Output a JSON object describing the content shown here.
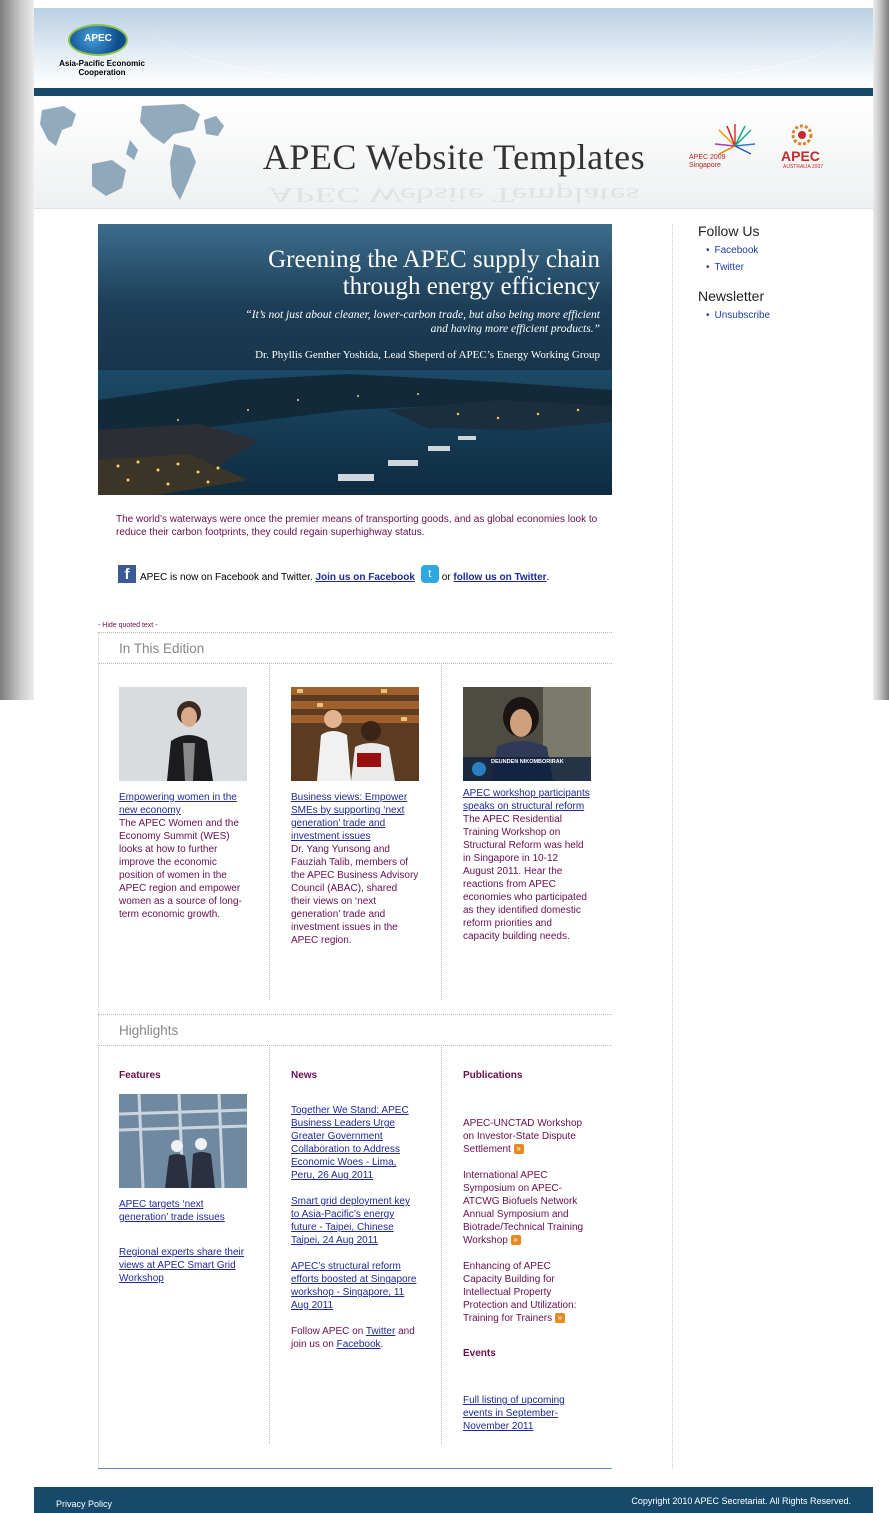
{
  "header": {
    "logo_short": "APEC",
    "logo_full": "Asia-Pacific Economic Cooperation",
    "banner_title": "APEC Website Templates",
    "logo_sg_text": "APEC 2009",
    "logo_sg_sub": "Singapore",
    "logo_au_text": "APEC",
    "logo_au_sub": "AUSTRALIA 2007"
  },
  "hero": {
    "title_line1": "Greening the APEC supply chain",
    "title_line2": "through energy efficiency",
    "quote": "“It’s not just about cleaner, lower-carbon trade, but also being more efficient and having more efficient products.”",
    "byline": "Dr. Phyllis Genther Yoshida, Lead Sheperd of APEC’s Energy Working Group"
  },
  "intro": "The world’s waterways were once the premier means of transporting goods, and as global economies look to reduce their carbon footprints, they could regain superhighway status.",
  "social": {
    "text": "APEC is now on Facebook and Twitter.",
    "fb_link": "Join us on Facebook",
    "or": "or",
    "tw_link": "follow us on Twitter",
    "end": "."
  },
  "hide_quoted": "- Hide quoted text -",
  "edition": {
    "heading": "In This Edition",
    "items": [
      {
        "link": "Empowering women in the new economy",
        "text": "The APEC Women and the Economy Summit (WES) looks at how to further improve the economic position of women in the APEC region and empower women as a source of long-term economic growth."
      },
      {
        "link": "Business views: Empower SMEs by supporting ‘next generation’ trade and investment issues",
        "text": "Dr. Yang Yunsong and Fauziah Talib, members of the APEC Business Advisory Council (ABAC), shared their views on ‘next generation’ trade and investment issues in the APEC region."
      },
      {
        "link": "APEC workshop participants speaks on structural reform",
        "text": "The APEC Residential Training Workshop on Structural Reform was held in Singapore in 10-12 August 2011. Hear the reactions from APEC economies who participated as they identified domestic reform priorities and capacity building needs.",
        "photo_caption": "DEUNDEN NIKOMBORIRAK"
      }
    ]
  },
  "highlights": {
    "heading": "Highlights",
    "features": {
      "heading": "Features",
      "links": [
        "APEC targets ‘next generation’ trade issues",
        "Regional experts share their views at APEC Smart Grid Workshop"
      ]
    },
    "news": {
      "heading": "News",
      "links": [
        "Together We Stand: APEC Business Leaders Urge Greater Government Collaboration to Address Economic Woes - Lima, Peru, 26 Aug 2011",
        "Smart grid deployment key to Asia-Pacific’s energy future - Taipei, Chinese Taipei, 24 Aug 2011",
        "APEC’s structural reform efforts boosted at Singapore workshop - Singapore, 11 Aug 2011"
      ],
      "follow_pre": "Follow APEC on",
      "follow_tw": "Twitter",
      "follow_mid": "and join us on",
      "follow_fb": "Facebook",
      "follow_end": "."
    },
    "publications": {
      "heading": "Publications",
      "items": [
        "APEC-UNCTAD Workshop on Investor-State Dispute Settlement",
        "International APEC Symposium on APEC-ATCWG Biofuels Network Annual Symposium and Biotrade/Technical Training Workshop",
        "Enhancing of APEC Capacity Building for Intellectual Property Protection and Utilization: Training for Trainers"
      ]
    },
    "events": {
      "heading": "Events",
      "link": "Full listing of upcoming events in September-November 2011"
    }
  },
  "sidebar": {
    "follow_heading": "Follow Us",
    "follow_items": [
      "Facebook",
      "Twitter"
    ],
    "newsletter_heading": "Newsletter",
    "newsletter_items": [
      "Unsubscribe"
    ]
  },
  "footer": {
    "privacy": "Privacy Policy",
    "copyright": "Copyright 2010 APEC Secretariat. All Rights Reserved."
  },
  "colors": {
    "navy": "#174a6a",
    "body_text": "#6a0e4e",
    "link": "#1f2a9a"
  }
}
